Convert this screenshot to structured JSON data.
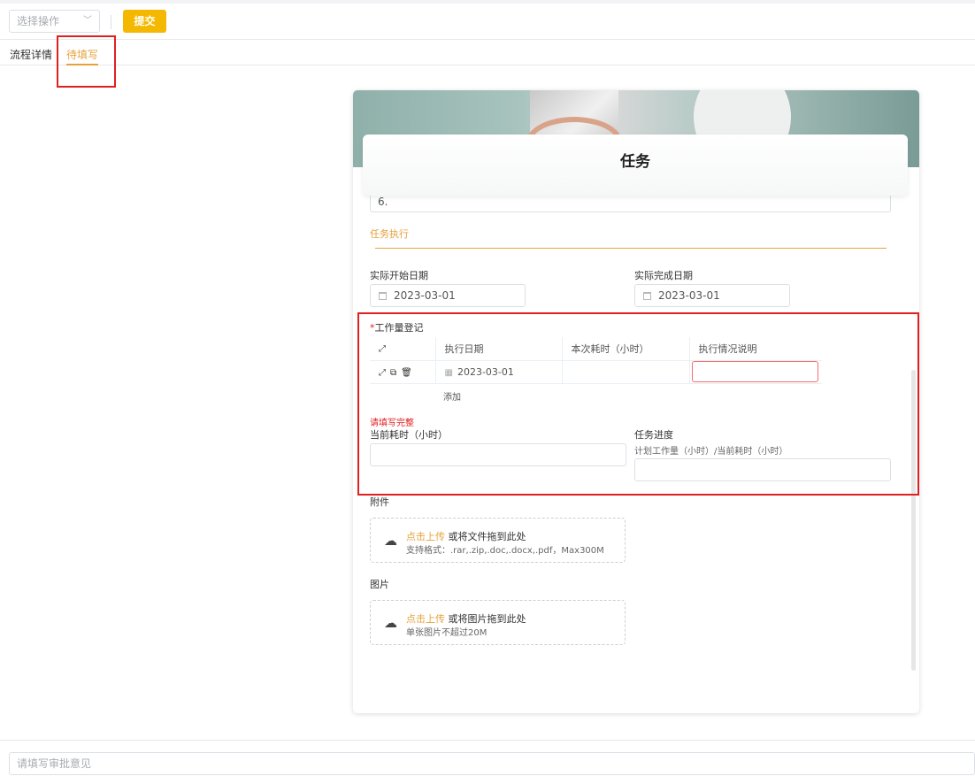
{
  "toolbar": {
    "select_placeholder": "选择操作",
    "submit_label": "提交"
  },
  "tabs": [
    {
      "label": "流程详情"
    },
    {
      "label": "待填写"
    }
  ],
  "form": {
    "title": "任务",
    "prev_field_value": "6.",
    "section_title": "任务执行",
    "actual_start_label": "实际开始日期",
    "actual_start_value": "2023-03-01",
    "actual_end_label": "实际完成日期",
    "actual_end_value": "2023-03-01",
    "worklog": {
      "label": "工作量登记",
      "required_mark": "*",
      "columns": [
        "执行日期",
        "本次耗时（小时）",
        "执行情况说明"
      ],
      "rows": [
        {
          "date": "2023-03-01",
          "hours": "",
          "description": ""
        }
      ],
      "add_label": "添加",
      "error": "请填写完整"
    },
    "current_hours_label": "当前耗时（小时）",
    "progress_label": "任务进度",
    "progress_hint": "计划工作量（小时）/当前耗时（小时）",
    "attachments": {
      "label": "附件",
      "upload_link": "点击上传",
      "upload_text": "或将文件拖到此处",
      "formats": "支持格式：.rar,.zip,.doc,.docx,.pdf，Max300M"
    },
    "images": {
      "label": "图片",
      "upload_link": "点击上传",
      "upload_text": "或将图片拖到此处",
      "limit": "单张图片不超过20M"
    }
  },
  "footer": {
    "comment_placeholder": "请填写审批意见"
  },
  "colors": {
    "accent": "#e6a23c",
    "submit": "#f5b800",
    "highlight": "#e02020"
  }
}
